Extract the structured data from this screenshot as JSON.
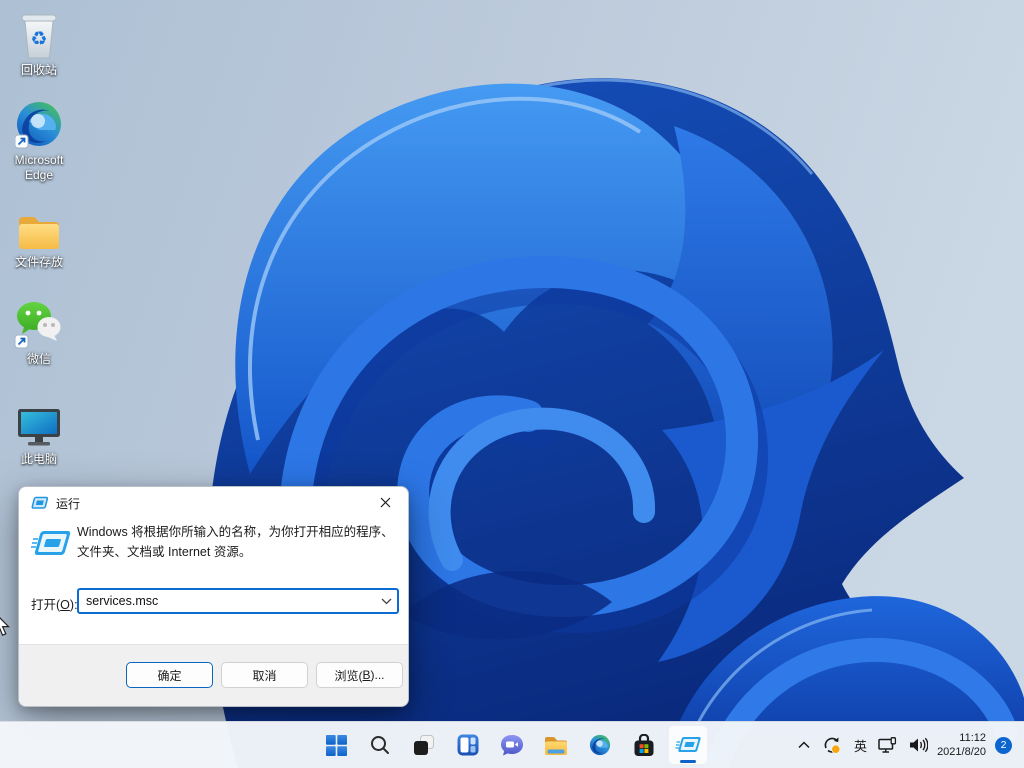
{
  "desktop_icons": [
    {
      "id": "recycle-bin",
      "label": "回收站"
    },
    {
      "id": "microsoft-edge",
      "label": "Microsoft Edge"
    },
    {
      "id": "file-folder",
      "label": "文件存放"
    },
    {
      "id": "wechat",
      "label": "微信"
    },
    {
      "id": "this-pc",
      "label": "此电脑"
    }
  ],
  "run_dialog": {
    "title": "运行",
    "description_line1": "Windows 将根据你所输入的名称，为你打开相应的程序、",
    "description_line2": "文件夹、文档或 Internet 资源。",
    "open_label_prefix": "打开(",
    "open_label_mnemonic": "O",
    "open_label_suffix": "):",
    "input_value": "services.msc",
    "buttons": {
      "ok": "确定",
      "cancel": "取消",
      "browse_prefix": "浏览(",
      "browse_mnemonic": "B",
      "browse_suffix": ")..."
    }
  },
  "taskbar": {
    "icons": [
      "start",
      "search",
      "task-view",
      "widgets",
      "chat",
      "file-explorer",
      "edge",
      "store",
      "run"
    ],
    "active_icon": "run"
  },
  "tray": {
    "ime_label": "英",
    "time": "11:12",
    "date": "2021/8/20",
    "notification_count": "2"
  },
  "colors": {
    "accent": "#0b66c2",
    "combo_border": "#0b6cd4",
    "badge": "#0d66d0",
    "taskbar_bg": "#f3f6fa",
    "bloom_bright": "#2c76e6",
    "bloom_dark": "#0b2d86",
    "desktop_bg_left": "#b0c3d6",
    "desktop_bg_right": "#c9d6e4"
  }
}
